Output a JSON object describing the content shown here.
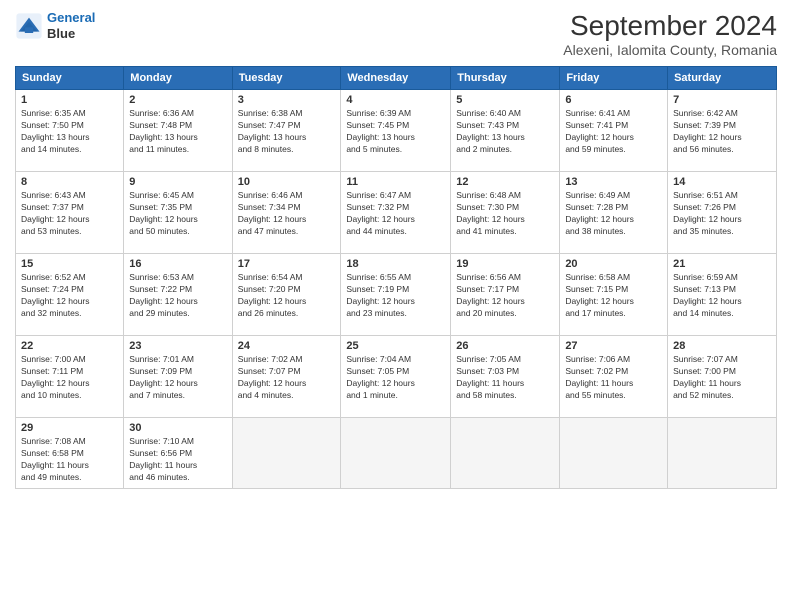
{
  "header": {
    "logo_line1": "General",
    "logo_line2": "Blue",
    "month_title": "September 2024",
    "subtitle": "Alexeni, Ialomita County, Romania"
  },
  "days_of_week": [
    "Sunday",
    "Monday",
    "Tuesday",
    "Wednesday",
    "Thursday",
    "Friday",
    "Saturday"
  ],
  "weeks": [
    [
      {
        "day": "1",
        "info": "Sunrise: 6:35 AM\nSunset: 7:50 PM\nDaylight: 13 hours\nand 14 minutes."
      },
      {
        "day": "2",
        "info": "Sunrise: 6:36 AM\nSunset: 7:48 PM\nDaylight: 13 hours\nand 11 minutes."
      },
      {
        "day": "3",
        "info": "Sunrise: 6:38 AM\nSunset: 7:47 PM\nDaylight: 13 hours\nand 8 minutes."
      },
      {
        "day": "4",
        "info": "Sunrise: 6:39 AM\nSunset: 7:45 PM\nDaylight: 13 hours\nand 5 minutes."
      },
      {
        "day": "5",
        "info": "Sunrise: 6:40 AM\nSunset: 7:43 PM\nDaylight: 13 hours\nand 2 minutes."
      },
      {
        "day": "6",
        "info": "Sunrise: 6:41 AM\nSunset: 7:41 PM\nDaylight: 12 hours\nand 59 minutes."
      },
      {
        "day": "7",
        "info": "Sunrise: 6:42 AM\nSunset: 7:39 PM\nDaylight: 12 hours\nand 56 minutes."
      }
    ],
    [
      {
        "day": "8",
        "info": "Sunrise: 6:43 AM\nSunset: 7:37 PM\nDaylight: 12 hours\nand 53 minutes."
      },
      {
        "day": "9",
        "info": "Sunrise: 6:45 AM\nSunset: 7:35 PM\nDaylight: 12 hours\nand 50 minutes."
      },
      {
        "day": "10",
        "info": "Sunrise: 6:46 AM\nSunset: 7:34 PM\nDaylight: 12 hours\nand 47 minutes."
      },
      {
        "day": "11",
        "info": "Sunrise: 6:47 AM\nSunset: 7:32 PM\nDaylight: 12 hours\nand 44 minutes."
      },
      {
        "day": "12",
        "info": "Sunrise: 6:48 AM\nSunset: 7:30 PM\nDaylight: 12 hours\nand 41 minutes."
      },
      {
        "day": "13",
        "info": "Sunrise: 6:49 AM\nSunset: 7:28 PM\nDaylight: 12 hours\nand 38 minutes."
      },
      {
        "day": "14",
        "info": "Sunrise: 6:51 AM\nSunset: 7:26 PM\nDaylight: 12 hours\nand 35 minutes."
      }
    ],
    [
      {
        "day": "15",
        "info": "Sunrise: 6:52 AM\nSunset: 7:24 PM\nDaylight: 12 hours\nand 32 minutes."
      },
      {
        "day": "16",
        "info": "Sunrise: 6:53 AM\nSunset: 7:22 PM\nDaylight: 12 hours\nand 29 minutes."
      },
      {
        "day": "17",
        "info": "Sunrise: 6:54 AM\nSunset: 7:20 PM\nDaylight: 12 hours\nand 26 minutes."
      },
      {
        "day": "18",
        "info": "Sunrise: 6:55 AM\nSunset: 7:19 PM\nDaylight: 12 hours\nand 23 minutes."
      },
      {
        "day": "19",
        "info": "Sunrise: 6:56 AM\nSunset: 7:17 PM\nDaylight: 12 hours\nand 20 minutes."
      },
      {
        "day": "20",
        "info": "Sunrise: 6:58 AM\nSunset: 7:15 PM\nDaylight: 12 hours\nand 17 minutes."
      },
      {
        "day": "21",
        "info": "Sunrise: 6:59 AM\nSunset: 7:13 PM\nDaylight: 12 hours\nand 14 minutes."
      }
    ],
    [
      {
        "day": "22",
        "info": "Sunrise: 7:00 AM\nSunset: 7:11 PM\nDaylight: 12 hours\nand 10 minutes."
      },
      {
        "day": "23",
        "info": "Sunrise: 7:01 AM\nSunset: 7:09 PM\nDaylight: 12 hours\nand 7 minutes."
      },
      {
        "day": "24",
        "info": "Sunrise: 7:02 AM\nSunset: 7:07 PM\nDaylight: 12 hours\nand 4 minutes."
      },
      {
        "day": "25",
        "info": "Sunrise: 7:04 AM\nSunset: 7:05 PM\nDaylight: 12 hours\nand 1 minute."
      },
      {
        "day": "26",
        "info": "Sunrise: 7:05 AM\nSunset: 7:03 PM\nDaylight: 11 hours\nand 58 minutes."
      },
      {
        "day": "27",
        "info": "Sunrise: 7:06 AM\nSunset: 7:02 PM\nDaylight: 11 hours\nand 55 minutes."
      },
      {
        "day": "28",
        "info": "Sunrise: 7:07 AM\nSunset: 7:00 PM\nDaylight: 11 hours\nand 52 minutes."
      }
    ],
    [
      {
        "day": "29",
        "info": "Sunrise: 7:08 AM\nSunset: 6:58 PM\nDaylight: 11 hours\nand 49 minutes."
      },
      {
        "day": "30",
        "info": "Sunrise: 7:10 AM\nSunset: 6:56 PM\nDaylight: 11 hours\nand 46 minutes."
      },
      {
        "day": "",
        "info": ""
      },
      {
        "day": "",
        "info": ""
      },
      {
        "day": "",
        "info": ""
      },
      {
        "day": "",
        "info": ""
      },
      {
        "day": "",
        "info": ""
      }
    ]
  ]
}
